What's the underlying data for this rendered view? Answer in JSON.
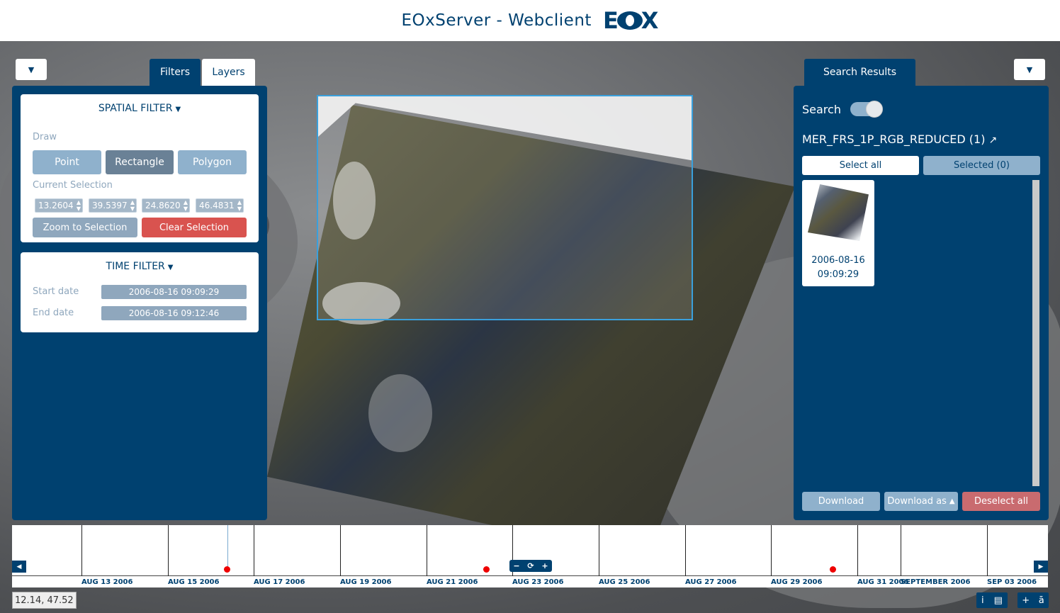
{
  "header": {
    "title": "EOxServer - Webclient",
    "logo": {
      "left": "E",
      "right": "X"
    }
  },
  "left_panel": {
    "toggle_icon": "chevron-down-icon",
    "tabs": [
      {
        "label": "Filters",
        "active": true
      },
      {
        "label": "Layers",
        "active": false
      }
    ],
    "spatial_filter": {
      "title": "SPATIAL FILTER",
      "draw_label": "Draw",
      "draw_buttons": [
        {
          "label": "Point"
        },
        {
          "label": "Rectangle",
          "active": true
        },
        {
          "label": "Polygon"
        }
      ],
      "current_selection_label": "Current Selection",
      "coords": [
        "13.2604",
        "39.5397",
        "24.8620",
        "46.4831"
      ],
      "zoom_button": "Zoom to Selection",
      "clear_button": "Clear Selection"
    },
    "time_filter": {
      "title": "TIME FILTER",
      "start_label": "Start date",
      "start_value": "2006-08-16 09:09:29",
      "end_label": "End date",
      "end_value": "2006-08-16 09:12:46"
    }
  },
  "right_panel": {
    "tab": "Search Results",
    "search_label": "Search",
    "search_enabled": true,
    "collection": "MER_FRS_1P_RGB_REDUCED (1)",
    "select_all": "Select all",
    "selected": "Selected (0)",
    "results": [
      {
        "line1": "2006-08-16",
        "line2": "09:09:29"
      }
    ],
    "download": "Download",
    "download_as": "Download as",
    "deselect_all": "Deselect all"
  },
  "timeline": {
    "ticks": [
      "AUG 13 2006",
      "AUG 15 2006",
      "AUG 17 2006",
      "AUG 19 2006",
      "AUG 21 2006",
      "AUG 23 2006",
      "AUG 25 2006",
      "AUG 27 2006",
      "AUG 29 2006",
      "AUG 31 2006",
      "SEPTEMBER 2006",
      "SEP 03 2006"
    ],
    "zoom_controls": [
      "−",
      "⟳",
      "+"
    ]
  },
  "coords_readout": "12.14, 47.52",
  "colors": {
    "brand": "#004170",
    "danger": "#d9534f",
    "event": "#ee0000"
  }
}
